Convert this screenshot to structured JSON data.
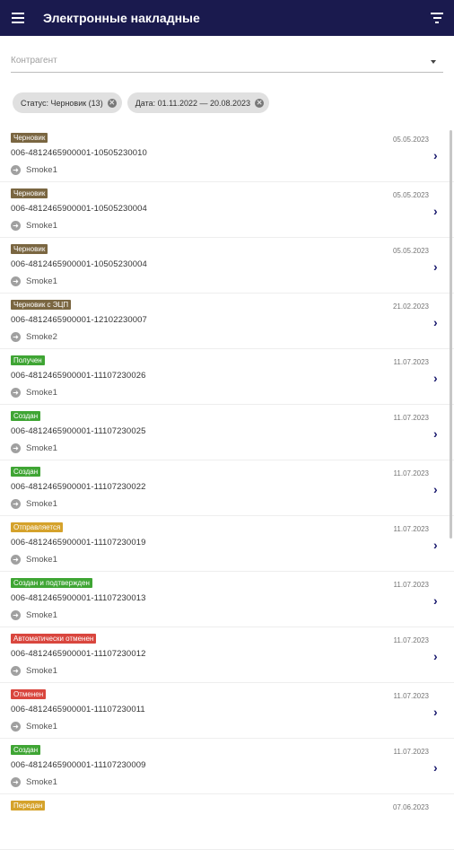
{
  "header": {
    "title": "Электронные накладные"
  },
  "kontragent": {
    "label": "Контрагент"
  },
  "chips": [
    {
      "label": "Статус: Черновик (13)"
    },
    {
      "label": "Дата: 01.11.2022 — 20.08.2023"
    }
  ],
  "colors": {
    "appbar": "#1a1a4e",
    "draft": "#7a6641",
    "green": "#3fa534",
    "yellow": "#d5a22b",
    "red": "#d9463e"
  },
  "items": [
    {
      "status": "Черновик",
      "color": "#7a6641",
      "number": "006-4812465900001-10505230010",
      "date": "05.05.2023",
      "partner": "Smoke1"
    },
    {
      "status": "Черновик",
      "color": "#7a6641",
      "number": "006-4812465900001-10505230004",
      "date": "05.05.2023",
      "partner": "Smoke1"
    },
    {
      "status": "Черновик",
      "color": "#7a6641",
      "number": "006-4812465900001-10505230004",
      "date": "05.05.2023",
      "partner": "Smoke1"
    },
    {
      "status": "Черновик с ЭЦП",
      "color": "#7a6641",
      "number": "006-4812465900001-12102230007",
      "date": "21.02.2023",
      "partner": "Smoke2"
    },
    {
      "status": "Получен",
      "color": "#3fa534",
      "number": "006-4812465900001-11107230026",
      "date": "11.07.2023",
      "partner": "Smoke1"
    },
    {
      "status": "Создан",
      "color": "#3fa534",
      "number": "006-4812465900001-11107230025",
      "date": "11.07.2023",
      "partner": "Smoke1"
    },
    {
      "status": "Создан",
      "color": "#3fa534",
      "number": "006-4812465900001-11107230022",
      "date": "11.07.2023",
      "partner": "Smoke1"
    },
    {
      "status": "Отправляется",
      "color": "#d5a22b",
      "number": "006-4812465900001-11107230019",
      "date": "11.07.2023",
      "partner": "Smoke1"
    },
    {
      "status": "Создан и подтвержден",
      "color": "#3fa534",
      "number": "006-4812465900001-11107230013",
      "date": "11.07.2023",
      "partner": "Smoke1"
    },
    {
      "status": "Автоматически отменен",
      "color": "#d9463e",
      "number": "006-4812465900001-11107230012",
      "date": "11.07.2023",
      "partner": "Smoke1"
    },
    {
      "status": "Отменен",
      "color": "#d9463e",
      "number": "006-4812465900001-11107230011",
      "date": "11.07.2023",
      "partner": "Smoke1"
    },
    {
      "status": "Создан",
      "color": "#3fa534",
      "number": "006-4812465900001-11107230009",
      "date": "11.07.2023",
      "partner": "Smoke1"
    },
    {
      "status": "Передан",
      "color": "#d5a22b",
      "number": "",
      "date": "07.06.2023",
      "partner": ""
    }
  ]
}
